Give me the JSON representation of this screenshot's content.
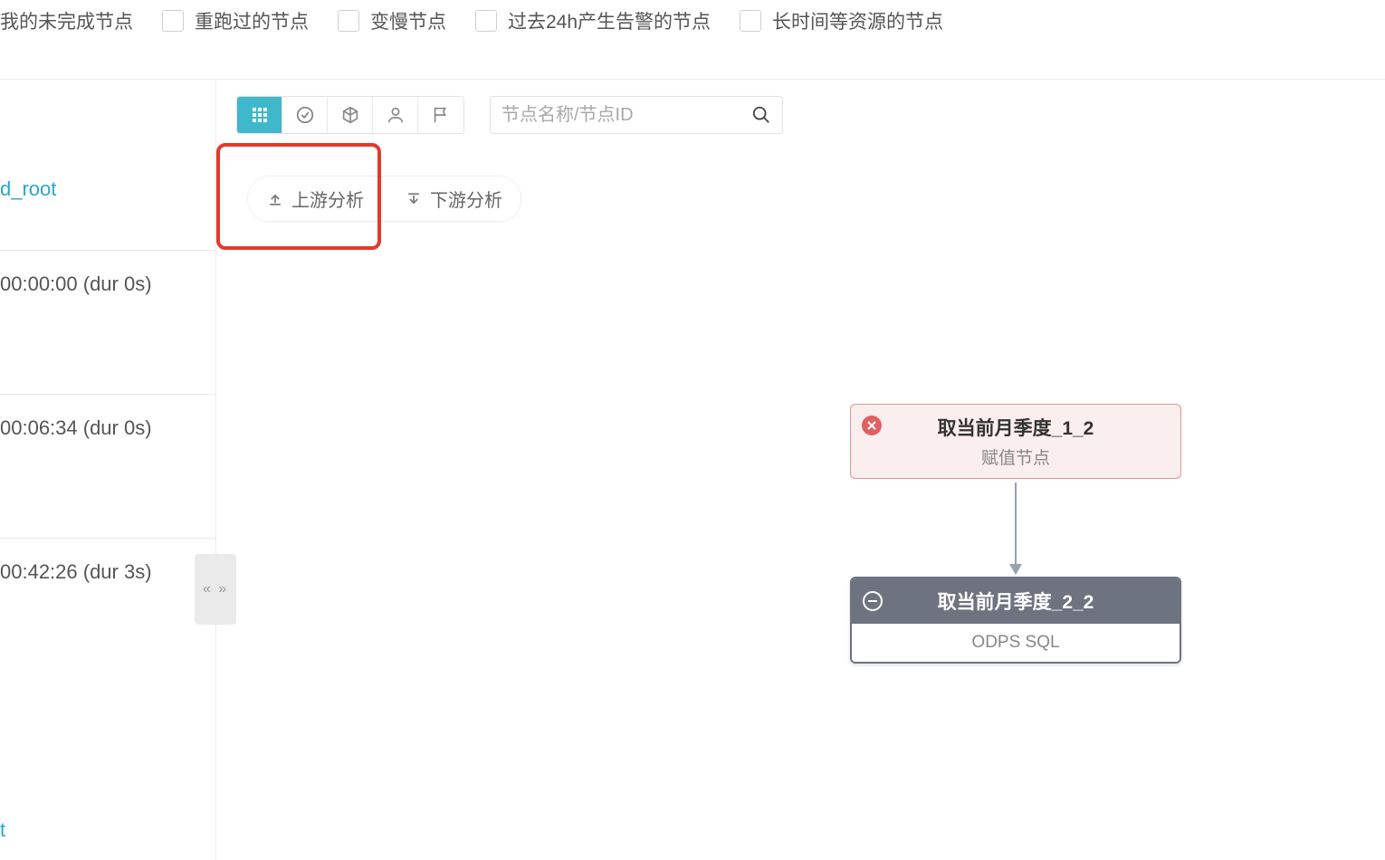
{
  "filters": {
    "items": [
      {
        "label": "我的未完成节点"
      },
      {
        "label": "重跑过的节点"
      },
      {
        "label": "变慢节点"
      },
      {
        "label": "过去24h产生告警的节点"
      },
      {
        "label": "长时间等资源的节点"
      }
    ]
  },
  "left": {
    "link": "d_root",
    "times": [
      "00:00:00 (dur 0s)",
      "00:06:34 (dur 0s)",
      "00:42:26 (dur 3s)"
    ],
    "bottom": "t"
  },
  "toolbar": {
    "search_placeholder": "节点名称/节点ID"
  },
  "analysis": {
    "upstream": "上游分析",
    "downstream": "下游分析"
  },
  "collapse": "«  »",
  "dag": {
    "node1": {
      "title": "取当前月季度_1_2",
      "subtitle": "赋值节点"
    },
    "node2": {
      "title": "取当前月季度_2_2",
      "subtitle": "ODPS SQL"
    }
  }
}
